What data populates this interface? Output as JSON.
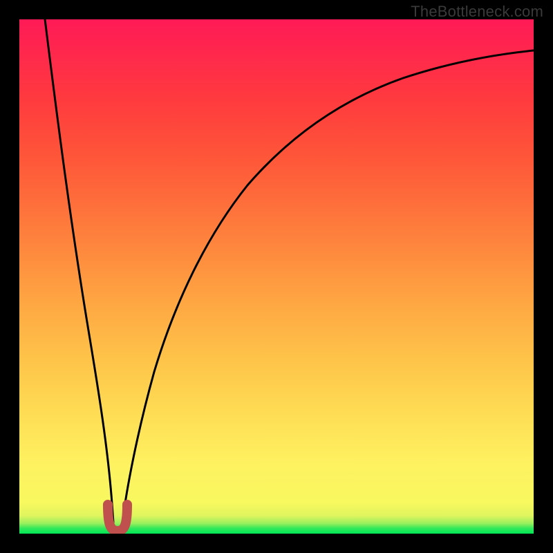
{
  "watermark": "TheBottleneck.com",
  "chart_data": {
    "type": "line",
    "title": "",
    "xlabel": "",
    "ylabel": "",
    "xlim": [
      0,
      1
    ],
    "ylim": [
      0,
      1
    ],
    "note": "No axes, ticks, or numeric labels visible. Curve shape reconstructed visually; minimum near x≈0.185.",
    "series": [
      {
        "name": "main-curve-left",
        "stroke": "#000000",
        "x": [
          0.05,
          0.075,
          0.1,
          0.125,
          0.15,
          0.172,
          0.18
        ],
        "y": [
          1.0,
          0.805,
          0.615,
          0.43,
          0.25,
          0.07,
          0.02
        ]
      },
      {
        "name": "main-curve-right",
        "stroke": "#000000",
        "x": [
          0.2,
          0.215,
          0.245,
          0.285,
          0.33,
          0.38,
          0.44,
          0.51,
          0.59,
          0.68,
          0.78,
          0.88,
          1.0
        ],
        "y": [
          0.02,
          0.08,
          0.2,
          0.33,
          0.445,
          0.545,
          0.635,
          0.71,
          0.77,
          0.82,
          0.855,
          0.88,
          0.9
        ]
      },
      {
        "name": "minimum-marker",
        "stroke": "#c0504d",
        "shape": "u",
        "x": [
          0.173,
          0.18,
          0.19,
          0.2,
          0.207
        ],
        "y": [
          0.05,
          0.012,
          0.005,
          0.012,
          0.05
        ]
      }
    ],
    "background_gradient": {
      "direction": "bottom-to-top",
      "stops": [
        {
          "pos": 0.0,
          "color": "#00e756"
        },
        {
          "pos": 0.06,
          "color": "#f8f85f"
        },
        {
          "pos": 0.5,
          "color": "#fe9a40"
        },
        {
          "pos": 0.85,
          "color": "#ff3b3e"
        },
        {
          "pos": 1.0,
          "color": "#ff1a57"
        }
      ]
    }
  }
}
